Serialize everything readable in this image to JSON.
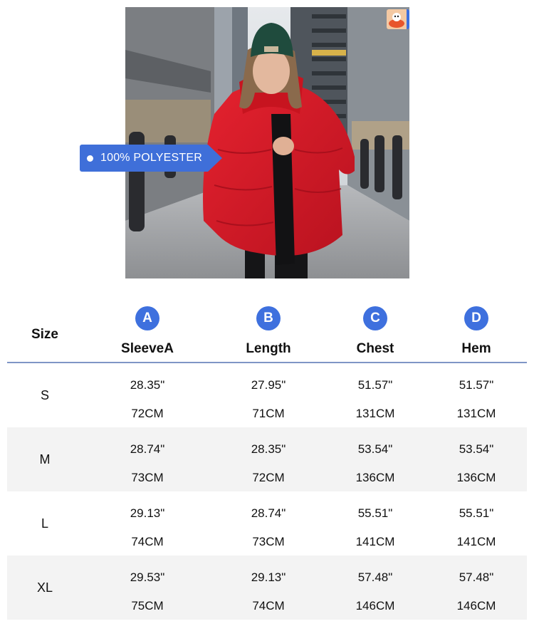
{
  "material_tag": {
    "text": "100% POLYESTER"
  },
  "table": {
    "size_header": "Size",
    "columns": [
      {
        "letter": "A",
        "label": "SleeveA"
      },
      {
        "letter": "B",
        "label": "Length"
      },
      {
        "letter": "C",
        "label": "Chest"
      },
      {
        "letter": "D",
        "label": "Hem"
      }
    ],
    "rows": [
      {
        "size": "S",
        "sleeve_in": "28.35\"",
        "sleeve_cm": "72CM",
        "length_in": "27.95\"",
        "length_cm": "71CM",
        "chest_in": "51.57\"",
        "chest_cm": "131CM",
        "hem_in": "51.57\"",
        "hem_cm": "131CM"
      },
      {
        "size": "M",
        "sleeve_in": "28.74\"",
        "sleeve_cm": "73CM",
        "length_in": "28.35\"",
        "length_cm": "72CM",
        "chest_in": "53.54\"",
        "chest_cm": "136CM",
        "hem_in": "53.54\"",
        "hem_cm": "136CM"
      },
      {
        "size": "L",
        "sleeve_in": "29.13\"",
        "sleeve_cm": "74CM",
        "length_in": "28.74\"",
        "length_cm": "73CM",
        "chest_in": "55.51\"",
        "chest_cm": "141CM",
        "hem_in": "55.51\"",
        "hem_cm": "141CM"
      },
      {
        "size": "XL",
        "sleeve_in": "29.53\"",
        "sleeve_cm": "75CM",
        "length_in": "29.13\"",
        "length_cm": "74CM",
        "chest_in": "57.48\"",
        "chest_cm": "146CM",
        "hem_in": "57.48\"",
        "hem_cm": "146CM"
      }
    ]
  },
  "colors": {
    "accent_blue": "#3e70de",
    "header_rule": "#7f95c6",
    "stripe": "#f3f3f3",
    "jacket_red": "#d5192b"
  }
}
